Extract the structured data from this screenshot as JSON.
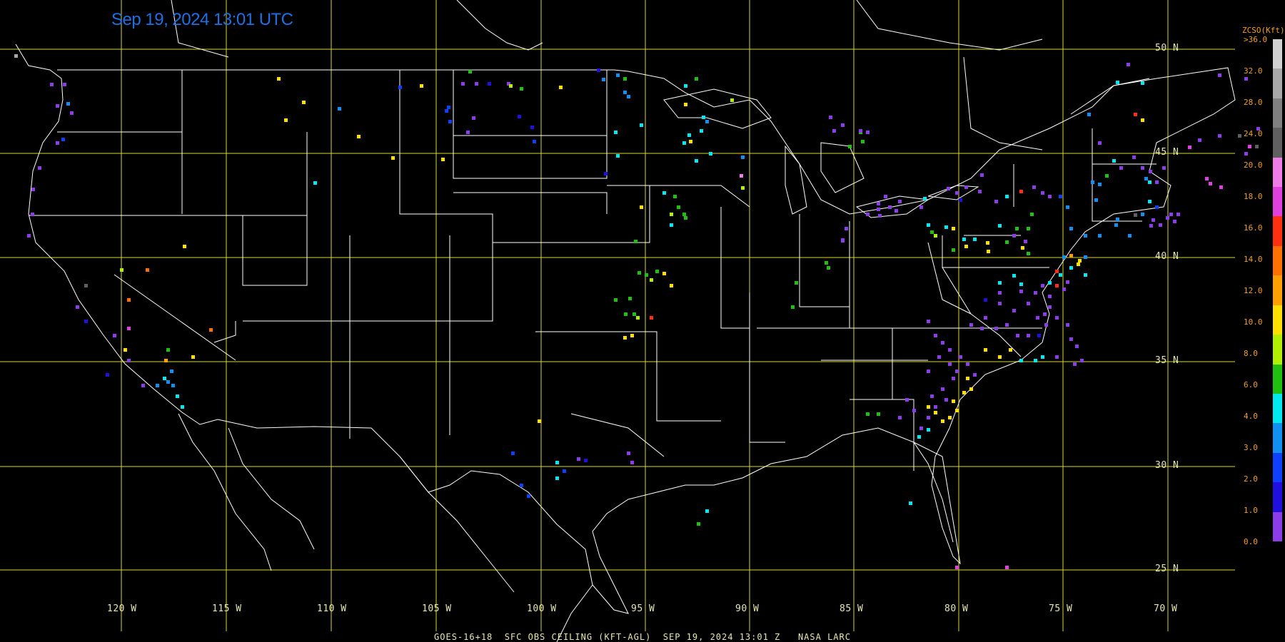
{
  "timestamp": "Sep 19, 2024 13:01 UTC",
  "footer": "GOES-16+18  SFC OBS CEILING (KFT-AGL)  SEP 19, 2024 13:01 Z   NASA LARC",
  "lat_labels": [
    "50 N",
    "45 N",
    "40 N",
    "35 N",
    "30 N",
    "25 N"
  ],
  "lon_labels": [
    "120 W",
    "115 W",
    "110 W",
    "105 W",
    "100 W",
    "95 W",
    "90 W",
    "85 W",
    "80 W",
    "75 W",
    "70 W"
  ],
  "colorbar": {
    "title": "ZCSO(Kft)",
    "labels": [
      ">36.0",
      "32.0",
      "28.0",
      "24.0",
      "20.0",
      "18.0",
      "16.0",
      "14.0",
      "12.0",
      "10.0",
      "8.0",
      "6.0",
      "4.0",
      "3.0",
      "2.0",
      "1.0",
      "0.0"
    ],
    "colors": [
      "#d0d0d0",
      "#a8a8a8",
      "#808080",
      "#606060",
      "#f07ce8",
      "#e040e0",
      "#ff3010",
      "#ff7000",
      "#ffa000",
      "#ffe000",
      "#b0f000",
      "#20c010",
      "#00e8f0",
      "#1090f0",
      "#1040ff",
      "#2010e0",
      "#8c3ce8"
    ]
  },
  "colors": {
    "grid": "#d8d830",
    "boundary": "#ffffff",
    "background": "#000000"
  }
}
